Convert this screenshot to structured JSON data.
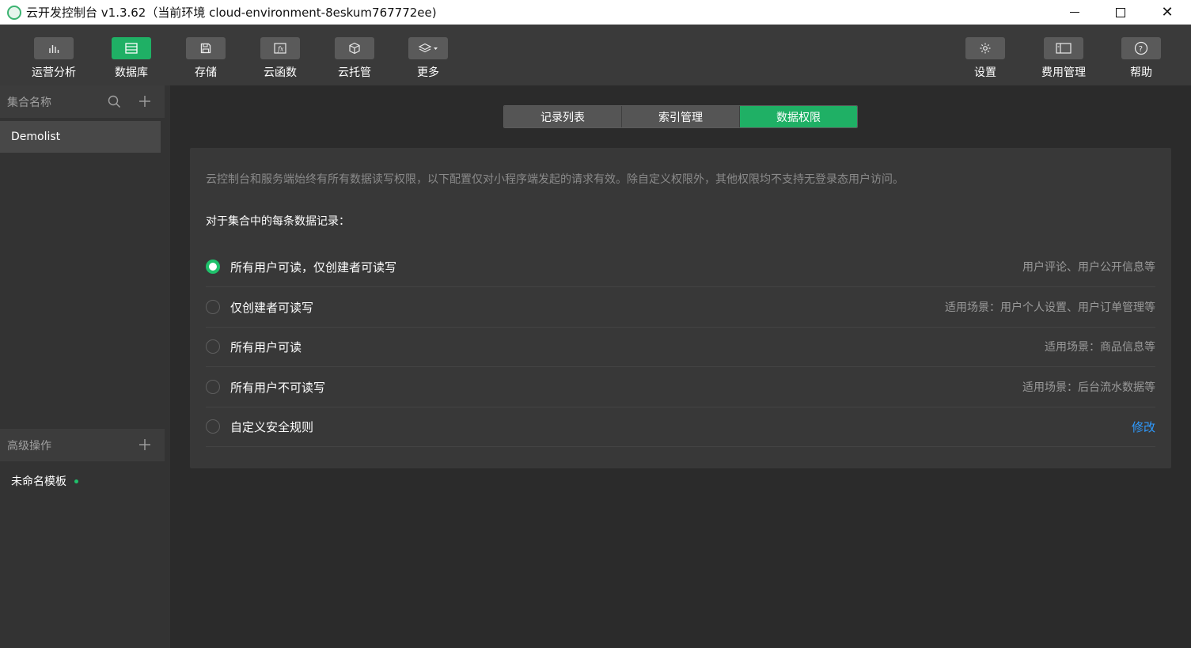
{
  "window": {
    "title": "云开发控制台 v1.3.62（当前环境 cloud-environment-8eskum767772ee)"
  },
  "toolbar": {
    "left": [
      {
        "label": "运营分析",
        "icon": "bar-chart-icon",
        "active": false
      },
      {
        "label": "数据库",
        "icon": "database-icon",
        "active": true
      },
      {
        "label": "存储",
        "icon": "save-icon",
        "active": false
      },
      {
        "label": "云函数",
        "icon": "function-icon",
        "active": false
      },
      {
        "label": "云托管",
        "icon": "cube-icon",
        "active": false
      },
      {
        "label": "更多",
        "icon": "layers-dropdown-icon",
        "active": false
      }
    ],
    "right": [
      {
        "label": "设置",
        "icon": "gear-icon"
      },
      {
        "label": "费用管理",
        "icon": "billing-icon"
      },
      {
        "label": "帮助",
        "icon": "help-icon"
      }
    ]
  },
  "sidebar": {
    "collections_header": "集合名称",
    "collections": [
      {
        "name": "Demolist",
        "selected": true
      }
    ],
    "advanced_header": "高级操作",
    "templates": [
      {
        "name": "未命名模板",
        "status_color": "#1fc16b"
      }
    ]
  },
  "main": {
    "tabs": [
      {
        "label": "记录列表",
        "active": false
      },
      {
        "label": "索引管理",
        "active": false
      },
      {
        "label": "数据权限",
        "active": true
      }
    ],
    "notice": "云控制台和服务端始终有所有数据读写权限，以下配置仅对小程序端发起的请求有效。除自定义权限外，其他权限均不支持无登录态用户访问。",
    "heading": "对于集合中的每条数据记录：",
    "options": [
      {
        "label": "所有用户可读，仅创建者可读写",
        "hint": "用户评论、用户公开信息等",
        "checked": true
      },
      {
        "label": "仅创建者可读写",
        "hint": "适用场景：用户个人设置、用户订单管理等",
        "checked": false
      },
      {
        "label": "所有用户可读",
        "hint": "适用场景：商品信息等",
        "checked": false
      },
      {
        "label": "所有用户不可读写",
        "hint": "适用场景：后台流水数据等",
        "checked": false
      },
      {
        "label": "自定义安全规则",
        "link": "修改",
        "checked": false
      }
    ]
  },
  "colors": {
    "accent": "#1fb065",
    "link": "#2f9bff"
  }
}
